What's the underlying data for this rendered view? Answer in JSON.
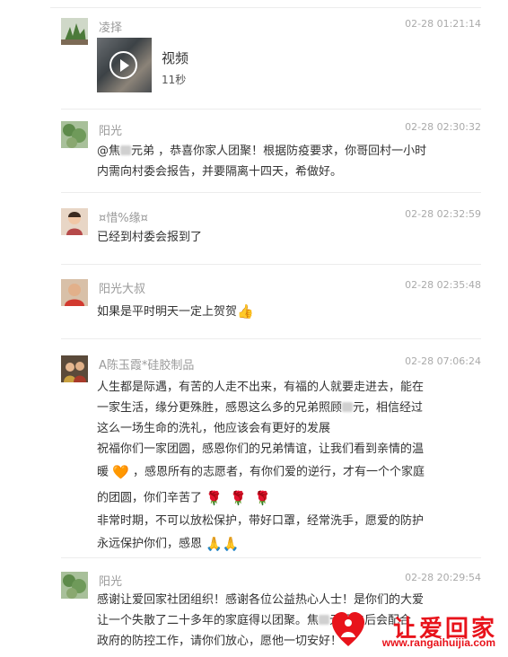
{
  "messages": [
    {
      "name": "凌择",
      "time": "02-28 01:21:14",
      "video": {
        "title": "视频",
        "duration": "11秒"
      }
    },
    {
      "name": "阳光",
      "time": "02-28 02:30:32",
      "lines": [
        "@焦",
        "元弟 ，恭喜你家人团聚！根据防疫要求，你哥回村一小时",
        "内需向村委会报告，并要隔离十四天，希做好。"
      ]
    },
    {
      "name": "¤惜%缘¤",
      "time": "02-28 02:32:59",
      "lines": [
        "已经到村委会报到了"
      ]
    },
    {
      "name": "阳光大叔",
      "time": "02-28 02:35:48",
      "lines": [
        "如果是平时明天一定上贺贺"
      ]
    },
    {
      "name": "A陈玉霞*硅胶制品",
      "time": "02-28 07:06:24",
      "lines": [
        "人生都是际遇，有苦的人走不出来，有福的人就要走进去，能在",
        "一家生活，缘分更殊胜，感恩这么多的兄弟照顾",
        "元，相信经过",
        "这么一场生命的洗礼，他应该会有更好的发展",
        "祝福你们一家团圆，感恩你们的兄弟情谊，让我们看到亲情的温",
        "暖",
        "，感恩所有的志愿者，有你们爱的逆行，才有一个个家庭",
        "的团圆，你们辛苦了",
        "非常时期，不可以放松保护，带好口罩，经常洗手，愿爱的防护",
        "永远保护你们，感恩"
      ]
    },
    {
      "name": "阳光",
      "time": "02-28 20:29:54",
      "lines": [
        "感谢让爱回家社团组织！感谢各位公益热心人士！是你们的大爱",
        "让一个失散了二十多年的家庭得以团聚。焦",
        "元回去后会配合",
        "政府的防控工作，请你们放心，愿他一切安好！"
      ]
    }
  ],
  "watermark": {
    "main": "让爱回家",
    "url": "www.rangaihuijia.com"
  },
  "emoji": {
    "thumbs_up": "👍",
    "heart": "🧡",
    "rose": "🌹",
    "pray": "🙏"
  }
}
